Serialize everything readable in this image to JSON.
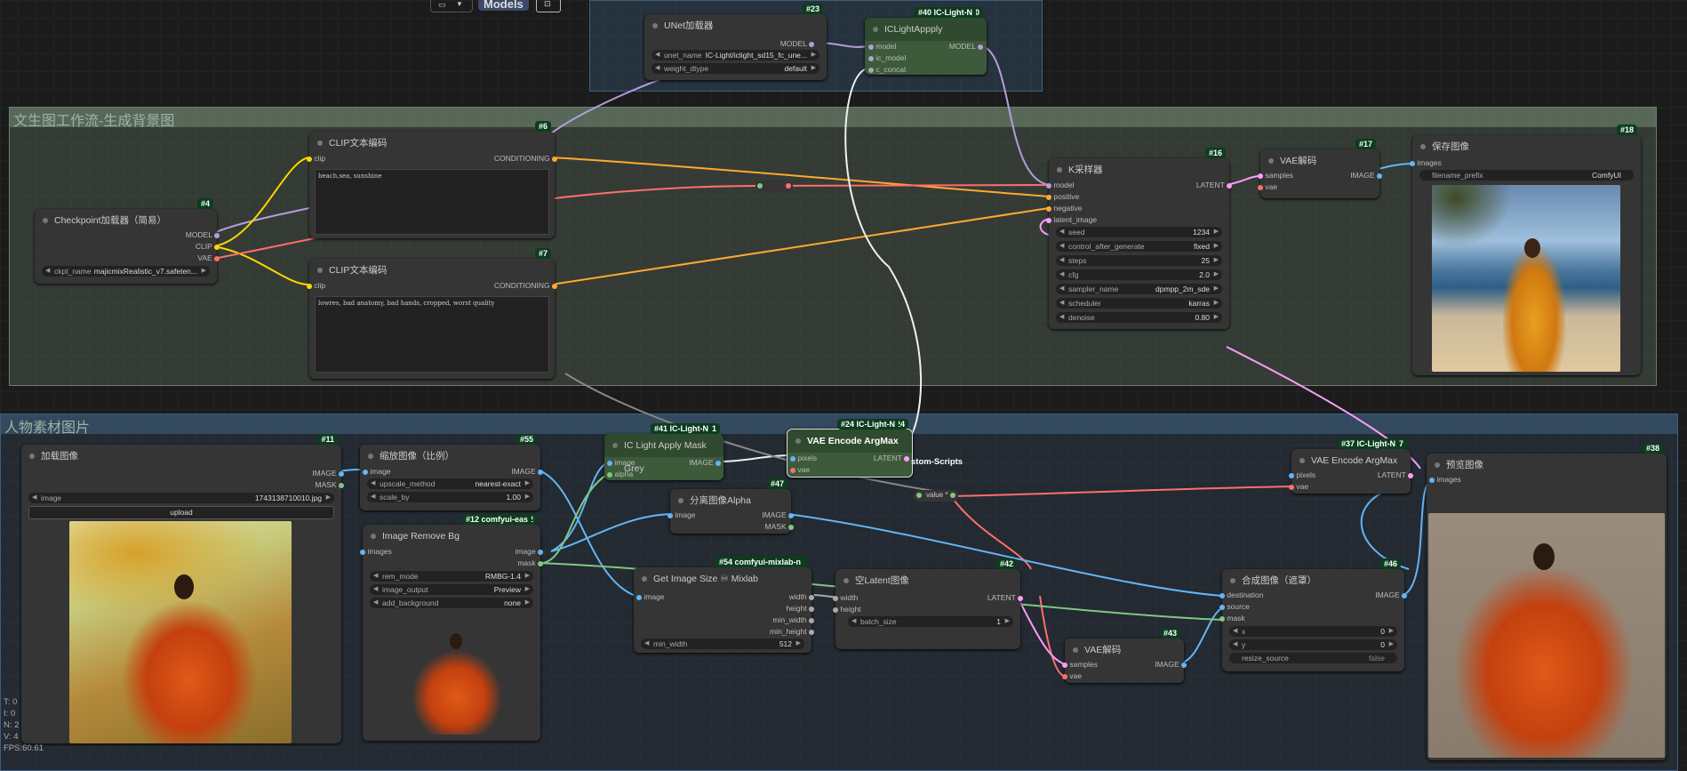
{
  "groups": {
    "top_title": "",
    "bg_title": "文生图工作流-生成背景图",
    "person_title": "人物素材图片"
  },
  "toolbar": {
    "models_label": "Models",
    "folder_icon": "folder-icon",
    "dropdown_icon": "chevron-down-icon",
    "queue_icon": "queue-icon"
  },
  "nodes": {
    "unet": {
      "title": "UNet加载器",
      "badge": "#23",
      "out": "MODEL",
      "w1_label": "unet_name",
      "w1_value": "IC-Light/iclight_sd15_fc_une...",
      "w2_label": "weight_dtype",
      "w2_value": "default"
    },
    "iclight_apply": {
      "title": "ICLightAppply",
      "badge": "#40 IC-Light-N",
      "badge2": "#40",
      "in1": "model",
      "in2": "ic_model",
      "in3": "c_concat",
      "out": "MODEL"
    },
    "clip1": {
      "title": "CLIP文本编码",
      "badge": "#6",
      "in": "clip",
      "out": "CONDITIONING",
      "text": "beach,sea, sunshine"
    },
    "clip2": {
      "title": "CLIP文本编码",
      "badge": "#7",
      "in": "clip",
      "out": "CONDITIONING",
      "text": "lowres, bad anatomy, bad hands, cropped, worst quality"
    },
    "checkpoint": {
      "title": "Checkpoint加载器（简易）",
      "badge": "#4",
      "out1": "MODEL",
      "out2": "CLIP",
      "out3": "VAE",
      "w_label": "ckpt_name",
      "w_value": "majicmixRealistic_v7.safeten..."
    },
    "ksampler": {
      "title": "K采样器",
      "badge": "#16",
      "in1": "model",
      "in2": "positive",
      "in3": "negative",
      "in4": "latent_image",
      "out": "LATENT",
      "widgets": [
        {
          "label": "seed",
          "value": "1234"
        },
        {
          "label": "control_after_generate",
          "value": "fixed"
        },
        {
          "label": "steps",
          "value": "25"
        },
        {
          "label": "cfg",
          "value": "2.0"
        },
        {
          "label": "sampler_name",
          "value": "dpmpp_2m_sde"
        },
        {
          "label": "scheduler",
          "value": "karras"
        },
        {
          "label": "denoise",
          "value": "0.80"
        }
      ]
    },
    "vae_decode1": {
      "title": "VAE解码",
      "badge": "#17",
      "in1": "samples",
      "in2": "vae",
      "out": "IMAGE"
    },
    "save_image": {
      "title": "保存图像",
      "badge": "#18",
      "in": "images",
      "w_label": "filename_prefix",
      "w_value": "ComfyUI"
    },
    "load_image": {
      "title": "加载图像",
      "badge": "#11",
      "out1": "IMAGE",
      "out2": "MASK",
      "w_label": "image",
      "w_value": "1743138710010.jpg",
      "upload": "upload"
    },
    "scale_image": {
      "title": "缩放图像（比例）",
      "badge": "#55",
      "in": "image",
      "out": "IMAGE",
      "w1_label": "upscale_method",
      "w1_value": "nearest-exact",
      "w2_label": "scale_by",
      "w2_value": "1.00"
    },
    "remove_bg": {
      "title": "Image Remove Bg",
      "badge": "#12 comfyui-eas",
      "badge2": "#12",
      "in": "images",
      "out1": "image",
      "out2": "mask",
      "w1_label": "rem_mode",
      "w1_value": "RMBG-1.4",
      "w2_label": "image_output",
      "w2_value": "Preview",
      "w3_label": "add_background",
      "w3_value": "none"
    },
    "mask_grey": {
      "title": "IC Light Apply Mask Grey",
      "badge": "#41 IC-Light-N",
      "badge2": "#41",
      "in1": "image",
      "in2": "alpha",
      "out": "IMAGE"
    },
    "vae_encode": {
      "title": "VAE Encode ArgMax",
      "badge": "#24 IC-Light-N",
      "badge2": "#24",
      "in1": "pixels",
      "in2": "vae",
      "out": "LATENT",
      "overlay": "stom-Scripts"
    },
    "split_alpha": {
      "title": "分离图像Alpha",
      "badge": "#47",
      "in": "image",
      "out1": "IMAGE",
      "out2": "MASK"
    },
    "get_size": {
      "title": "Get Image Size ♾ Mixlab",
      "badge": "#54 comfyui-mixlab-n",
      "badge2": "#54",
      "in": "image",
      "out1": "width",
      "out2": "height",
      "out3": "min_width",
      "out4": "min_height",
      "w_label": "min_width",
      "w_value": "512"
    },
    "empty_latent": {
      "title": "空Latent图像",
      "badge": "#42",
      "in1": "width",
      "in2": "height",
      "out": "LATENT",
      "w_label": "batch_size",
      "w_value": "1"
    },
    "vae_decode2": {
      "title": "VAE解码",
      "badge": "#43",
      "in1": "samples",
      "in2": "vae",
      "out": "IMAGE"
    },
    "vae_encode2": {
      "title": "VAE Encode ArgMax",
      "badge": "#37 IC-Light-N",
      "badge2": "#37",
      "in1": "pixels",
      "in2": "vae",
      "out": "LATENT"
    },
    "composite": {
      "title": "合成图像（遮罩）",
      "badge": "#46",
      "in1": "destination",
      "in2": "source",
      "in3": "mask",
      "out": "IMAGE",
      "w1_label": "x",
      "w1_value": "0",
      "w2_label": "y",
      "w2_value": "0",
      "w3_label": "resize_source",
      "w3_value": "false"
    },
    "preview": {
      "title": "预览图像",
      "badge": "#38",
      "in": "images"
    },
    "reroute": {
      "label": "value *"
    }
  },
  "stats": {
    "t": "T: 0",
    "i": "I: 0",
    "n": "N: 2",
    "v": "V: 4",
    "fps": "FPS:60.61"
  },
  "colors": {
    "model": "#b39ddb",
    "clip": "#ffd500",
    "vae": "#ff6e6e",
    "conditioning": "#ffa931",
    "latent": "#ff9cf9",
    "image": "#64b5f6",
    "mask": "#81c784"
  }
}
